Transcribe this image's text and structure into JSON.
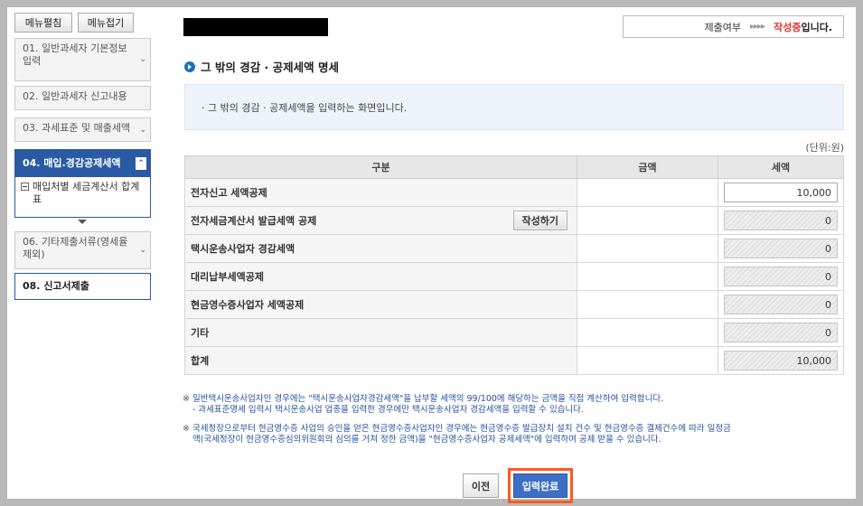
{
  "sidebar": {
    "expand_all": "메뉴펼침",
    "collapse_all": "메뉴접기",
    "items": [
      {
        "label": "01. 일반과세자 기본정보 입력"
      },
      {
        "label": "02. 일반과세자 신고내용"
      },
      {
        "label": "03. 과세표준 및 매출세액"
      },
      {
        "label": "04. 매입.경감공제세액"
      },
      {
        "label": "06. 기타제출서류(영세율 제외)"
      },
      {
        "label": "08. 신고서제출"
      }
    ],
    "sub_items": [
      {
        "label": "매입처별 세금계산서 합계표"
      }
    ]
  },
  "status": {
    "prefix": "제출여부",
    "arrows": "▸▸▸▸",
    "state": "작성중",
    "suffix": "입니다."
  },
  "section": {
    "title": "그 밖의 경감 · 공제세액 명세",
    "info": "· 그 밖의 경감 · 공제세액을 입력하는 화면입니다.",
    "unit": "(단위:원)"
  },
  "table": {
    "headers": {
      "category": "구분",
      "amount": "금액",
      "tax": "세액"
    },
    "write_button": "작성하기",
    "rows": [
      {
        "label": "전자신고 세액공제",
        "tax": "10,000"
      },
      {
        "label": "전자세금계산서 발급세액 공제",
        "tax": "0"
      },
      {
        "label": "택시운송사업자 경감세액",
        "tax": "0"
      },
      {
        "label": "대리납부세액공제",
        "tax": "0"
      },
      {
        "label": "현금영수증사업자 세액공제",
        "tax": "0"
      },
      {
        "label": "기타",
        "tax": "0"
      },
      {
        "label": "합계",
        "tax": "10,000"
      }
    ]
  },
  "notes": {
    "mark": "※",
    "note1_line1": "일반택시운송사업자인 경우에는 \"택시운송사업자경감세액\"을 납부할 세액의 99/100에 해당하는 금액을 직접 계산하여 입력합니다.",
    "note1_line2": "- 과세표준명세 입력시 택시운송사업 업종을 입력한 경우에만 택시운송사업자 경감세액을 입력할 수 있습니다.",
    "note2_line1": "국세청장으로부터 현금영수증 사업의 승인을 얻은 현금영수증사업자인 경우에는 현금영수증 발급장치 설치 건수 및 현금영수증 결제건수에 따라 일정금",
    "note2_line2": "액(국세청장이 현금영수증심의위원회의 심의를 거쳐 정한 금액)을 \"현금영수증사업자 공제세액\"에 입력하여 공제 받을 수 있습니다."
  },
  "buttons": {
    "prev": "이전",
    "done": "입력완료"
  }
}
